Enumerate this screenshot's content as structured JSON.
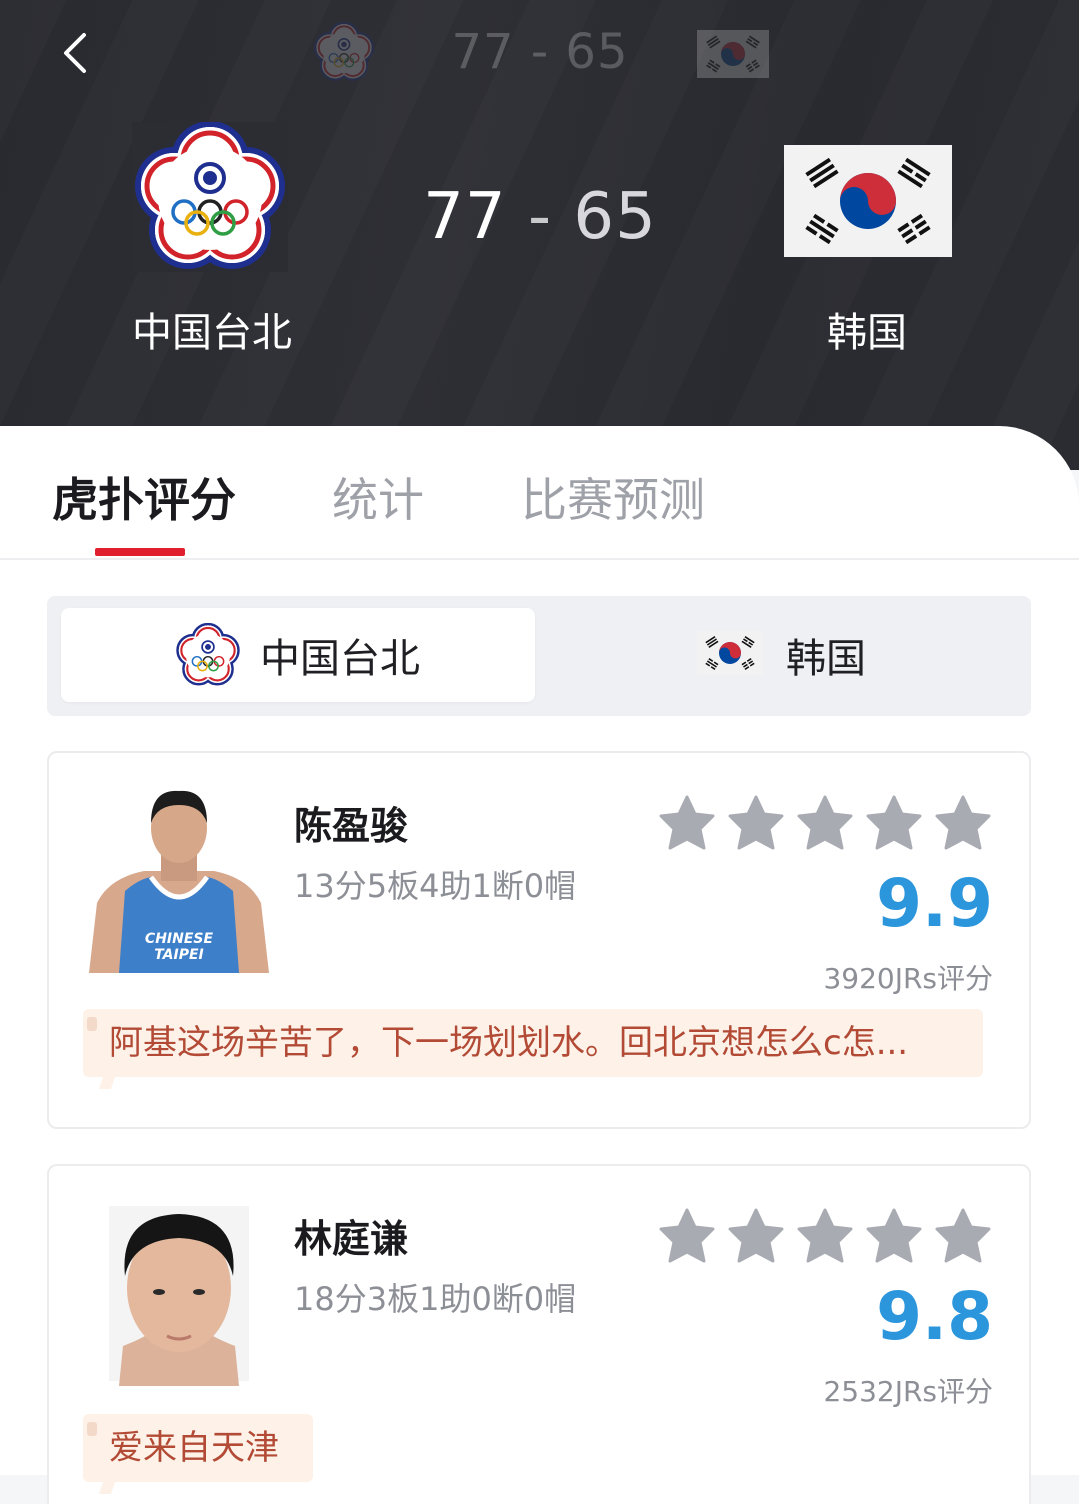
{
  "header": {
    "back_icon": "chevron-left-icon",
    "compact": {
      "home_score": "77",
      "away_score": "65",
      "separator": "-"
    },
    "main": {
      "home_score": "77",
      "away_score": "65",
      "separator": "-"
    },
    "home_team": {
      "name": "中国台北",
      "logo": "chinese-taipei-olympic-emblem"
    },
    "away_team": {
      "name": "韩国",
      "logo": "south-korea-flag"
    }
  },
  "tabs": [
    {
      "label": "虎扑评分",
      "active": true
    },
    {
      "label": "统计",
      "active": false
    },
    {
      "label": "比赛预测",
      "active": false
    }
  ],
  "team_switcher": {
    "options": [
      {
        "label": "中国台北",
        "icon": "chinese-taipei-olympic-emblem",
        "selected": true
      },
      {
        "label": "韩国",
        "icon": "south-korea-flag",
        "selected": false
      }
    ]
  },
  "players": [
    {
      "name": "陈盈骏",
      "stats": "13分5板4助1断0帽",
      "rating": "9.9",
      "votes": "3920JRs评分",
      "comment": "阿基这场辛苦了，下一场划划水。回北京想怎么c怎...",
      "stars": 5
    },
    {
      "name": "林庭谦",
      "stats": "18分3板1助0断0帽",
      "rating": "9.8",
      "votes": "2532JRs评分",
      "comment": "爱来自天津",
      "stars": 5
    }
  ],
  "colors": {
    "header_bg": "#2c2d33",
    "tab_indicator": "#e0202f",
    "rating_blue": "#2b96dc",
    "star_gray": "#a9abb3",
    "comment_bg": "#fdf1e8",
    "comment_text": "#b24a35"
  }
}
